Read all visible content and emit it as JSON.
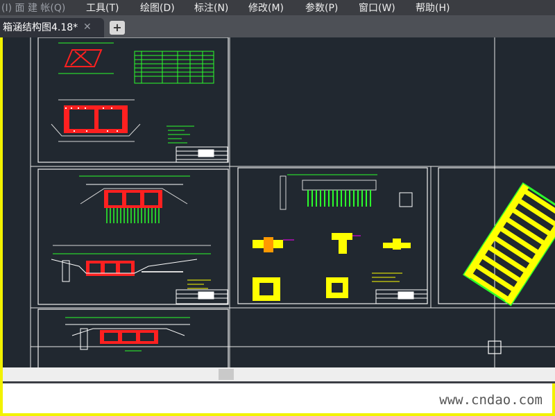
{
  "menu": {
    "items": [
      {
        "label": "(I) 面 建 帐(Q)"
      },
      {
        "label": "工具(T)"
      },
      {
        "label": "绘图(D)"
      },
      {
        "label": "标注(N)"
      },
      {
        "label": "修改(M)"
      },
      {
        "label": "参数(P)"
      },
      {
        "label": "窗口(W)"
      },
      {
        "label": "帮助(H)"
      }
    ]
  },
  "tabs": {
    "active_label": "箱涵结构图4.18*",
    "close_glyph": "✕",
    "add_glyph": "+"
  },
  "watermark": "www.cndao.com",
  "colors": {
    "background": "#212830",
    "menubar": "#3b3d42",
    "accent": "#f2f200",
    "drawing_red": "#ff1e1e",
    "drawing_green": "#2cff2c",
    "drawing_yellow": "#ffff00"
  }
}
